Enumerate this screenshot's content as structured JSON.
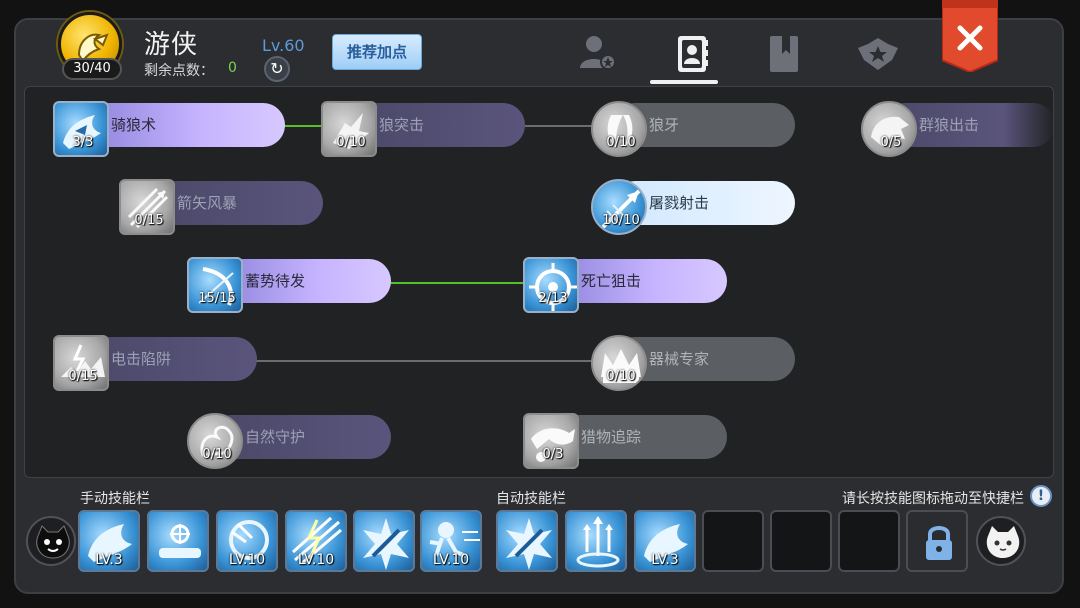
{
  "header": {
    "class_name": "游侠",
    "skill_points": "30/40",
    "level": "Lv.60",
    "remaining_label": "剩余点数：",
    "remaining_value": "0",
    "recommend_label": "推荐加点",
    "tabs": [
      {
        "icon": "character-icon"
      },
      {
        "icon": "skill-book-icon",
        "active": true
      },
      {
        "icon": "bookmark-book-icon"
      },
      {
        "icon": "rank-emblem-icon"
      }
    ],
    "close_icon": "close-icon"
  },
  "skills": [
    {
      "name": "骑狼术",
      "level": "3/3",
      "state": "learned",
      "icon": "wolf-ride-icon"
    },
    {
      "name": "狼突击",
      "level": "0/10",
      "state": "locked",
      "icon": "wolf-charge-icon"
    },
    {
      "name": "狼牙",
      "level": "0/10",
      "state": "gray",
      "icon": "fang-icon"
    },
    {
      "name": "群狼出击",
      "level": "0/5",
      "state": "fade",
      "icon": "wolf-pack-icon"
    },
    {
      "name": "箭矢风暴",
      "level": "0/15",
      "state": "locked",
      "icon": "arrow-storm-icon"
    },
    {
      "name": "屠戮射击",
      "level": "10/10",
      "state": "whiteblue",
      "icon": "slaughter-shot-icon"
    },
    {
      "name": "蓄势待发",
      "level": "15/15",
      "state": "learned",
      "icon": "ready-bow-icon"
    },
    {
      "name": "死亡狙击",
      "level": "2/13",
      "state": "learned",
      "icon": "crosshair-icon"
    },
    {
      "name": "电击陷阱",
      "level": "0/15",
      "state": "locked",
      "icon": "shock-trap-icon"
    },
    {
      "name": "器械专家",
      "level": "0/10",
      "state": "gray",
      "icon": "crown-icon"
    },
    {
      "name": "自然守护",
      "level": "0/10",
      "state": "locked",
      "icon": "nature-guard-icon"
    },
    {
      "name": "猎物追踪",
      "level": "0/3",
      "state": "gray",
      "icon": "hunt-track-icon"
    }
  ],
  "bottom": {
    "manual_title": "手动技能栏",
    "auto_title": "自动技能栏",
    "hint": "请长按技能图标拖动至快捷栏",
    "info_icon": "!",
    "manual_slots": [
      {
        "icon": "wolf-ride-icon",
        "lv": "LV.3"
      },
      {
        "icon": "heal-lying-icon",
        "lv": ""
      },
      {
        "icon": "dash-wheel-icon",
        "lv": "LV.10"
      },
      {
        "icon": "lightning-arrows-icon",
        "lv": "LV.10"
      },
      {
        "icon": "sword-burst-icon",
        "lv": ""
      },
      {
        "icon": "runner-icon",
        "lv": "LV.10"
      }
    ],
    "auto_slots": [
      {
        "icon": "sword-burst-icon",
        "lv": "",
        "type": "filled"
      },
      {
        "icon": "arrow-rain-icon",
        "lv": "",
        "type": "filled"
      },
      {
        "icon": "wolf-ride-icon",
        "lv": "LV.3",
        "type": "filled"
      },
      {
        "icon": "",
        "lv": "",
        "type": "empty"
      },
      {
        "icon": "",
        "lv": "",
        "type": "empty"
      },
      {
        "icon": "",
        "lv": "",
        "type": "empty"
      },
      {
        "icon": "lock-icon",
        "lv": "",
        "type": "locked"
      }
    ],
    "left_mascot": "black-cat-icon",
    "right_mascot": "white-cat-icon"
  }
}
